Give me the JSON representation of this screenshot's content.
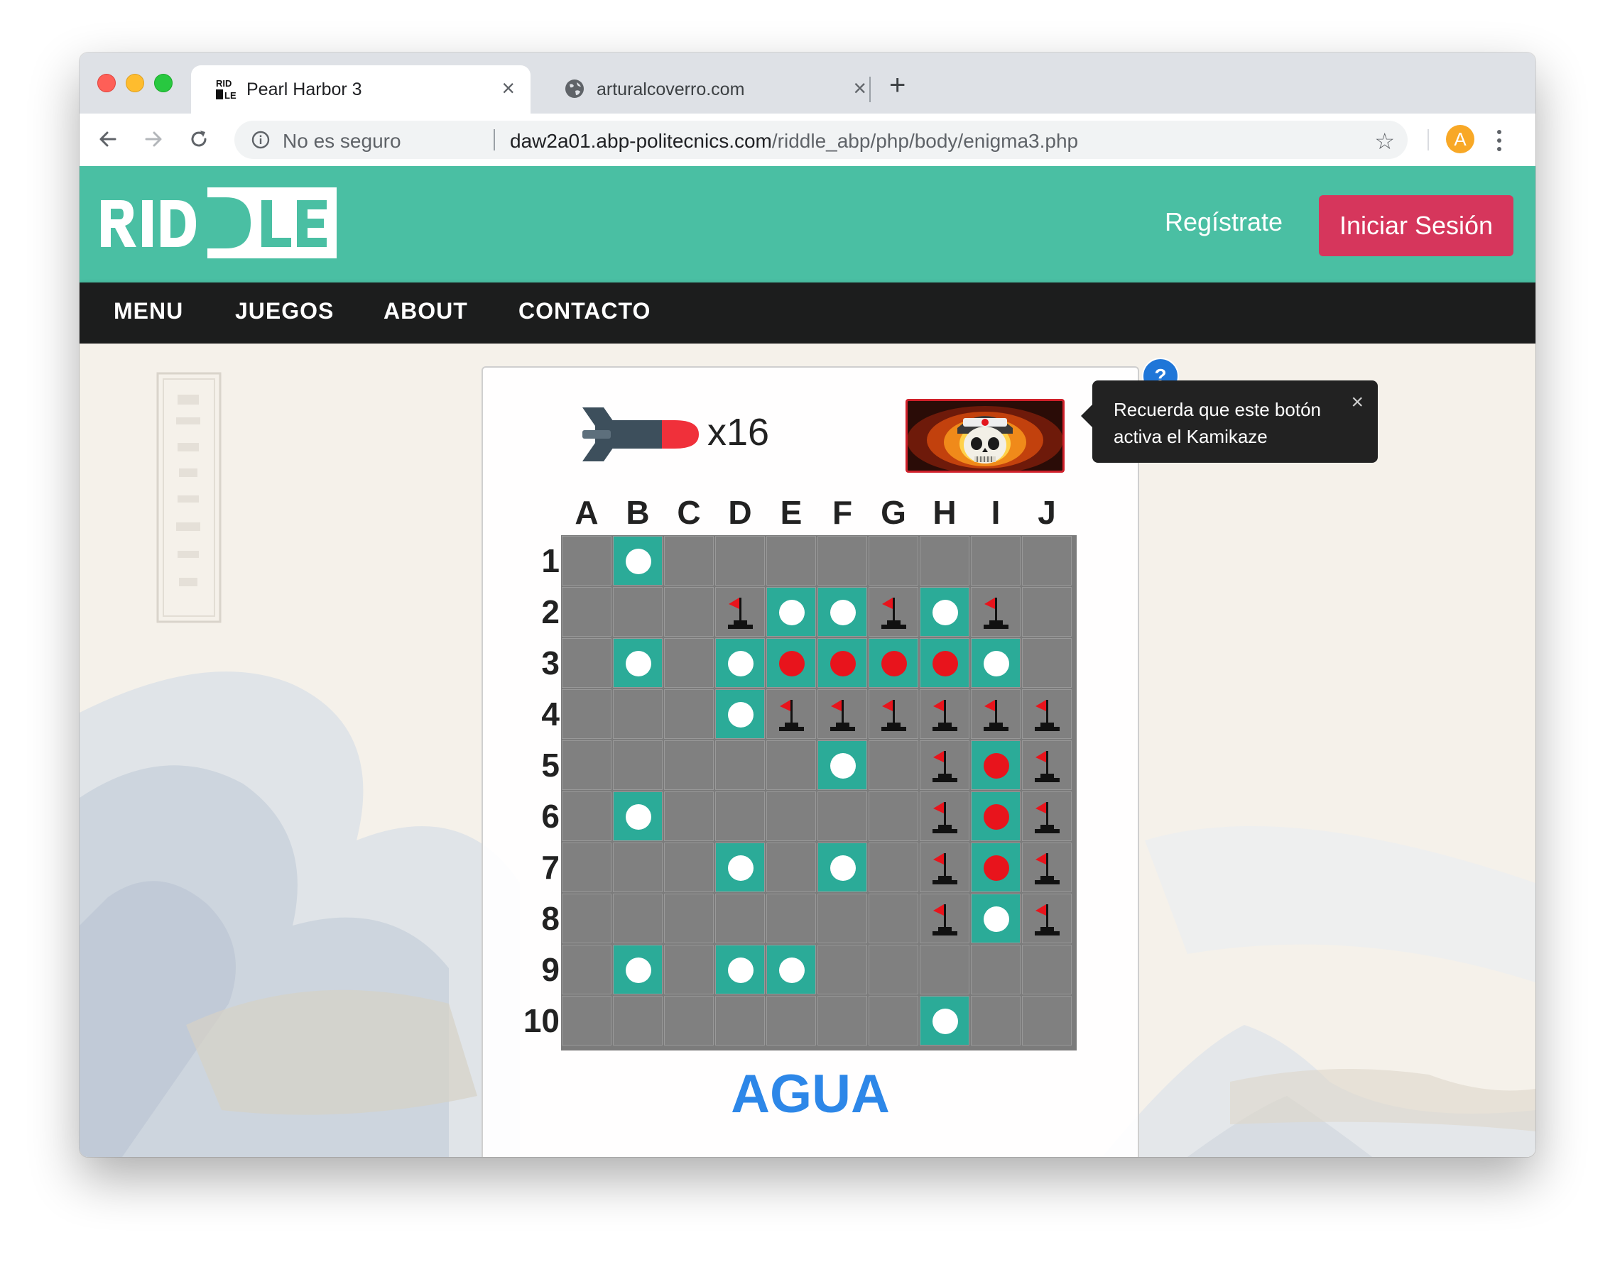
{
  "browser": {
    "tabs": [
      {
        "title": "Pearl Harbor 3",
        "active": true,
        "favicon": "riddle-favicon"
      },
      {
        "title": "arturalcoverro.com",
        "active": false,
        "favicon": "globe-icon"
      }
    ],
    "address_bar": {
      "security_label": "No es seguro",
      "url_host": "daw2a01.abp-politecnics.com",
      "url_path": "/riddle_abp/php/body/enigma3.php"
    },
    "profile_initial": "A"
  },
  "site": {
    "header": {
      "register_label": "Regístrate",
      "login_label": "Iniciar Sesión"
    },
    "nav": [
      "MENU",
      "JUEGOS",
      "ABOUT",
      "CONTACTO"
    ]
  },
  "game": {
    "bomb_count_label": "x16",
    "kamikaze_tooltip": "Recuerda que este botón activa el Kamikaze",
    "help_badge": "?",
    "columns": [
      "A",
      "B",
      "C",
      "D",
      "E",
      "F",
      "G",
      "H",
      "I",
      "J"
    ],
    "rows": [
      "1",
      "2",
      "3",
      "4",
      "5",
      "6",
      "7",
      "8",
      "9",
      "10"
    ],
    "grid": [
      ". w . . . . . . . .",
      ". . . f w w f w f .",
      ". w . w r r r r w .",
      ". . . w f f f f f f",
      ". . . . . w . f r f",
      ". w . . . . . f r f",
      ". . . w . w . f r f",
      ". . . . . . . f w f",
      ". w . w w . . . . .",
      ". . . . . . . w . ."
    ],
    "result": "AGUA",
    "colors": {
      "board_cell": "#808080",
      "revealed_cell": "#2bab98",
      "hit_peg": "#e8141c",
      "miss_peg": "#ffffff",
      "result_text": "#2d87e8",
      "header_teal": "#4abfa3",
      "login_red": "#d6365c"
    }
  }
}
